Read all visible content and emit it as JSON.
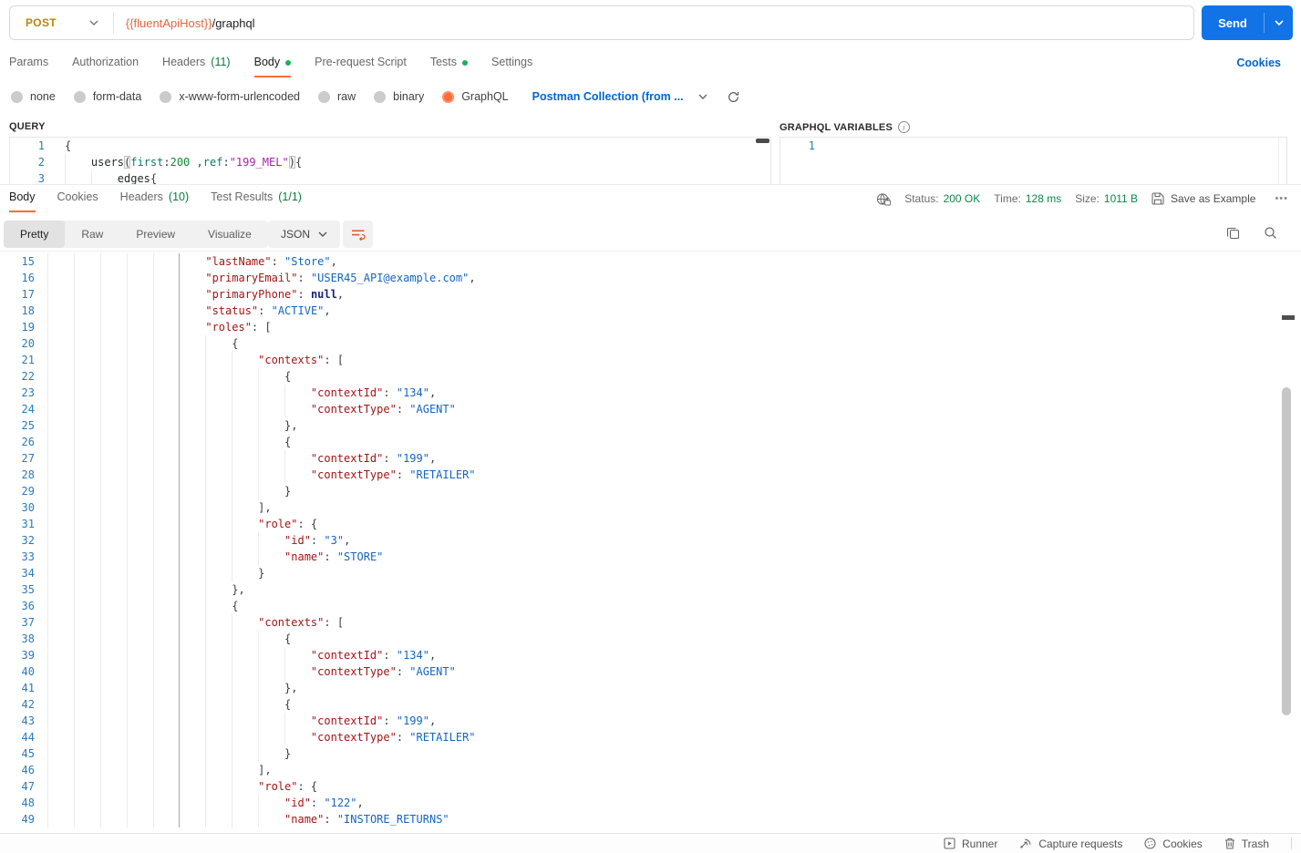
{
  "colors": {
    "accent": "#ff6c37",
    "link": "#0265d2",
    "send_button": "#1173e6",
    "method_post": "#b7860f",
    "url_variable": "#ef6240",
    "success_green": "#077d3e",
    "status_green": "#0a8a4a",
    "dot_green": "#1bb05c",
    "json_key": "#a31515",
    "json_string": "#1565c0",
    "json_null": "#1a237e",
    "line_number": "#2a7ab9"
  },
  "request": {
    "method": "POST",
    "url": {
      "variable": "{{fluentApiHost}}",
      "path": "/graphql"
    },
    "send_label": "Send",
    "cookies_link": "Cookies",
    "tabs": [
      {
        "label": "Params"
      },
      {
        "label": "Authorization"
      },
      {
        "label": "Headers",
        "count": "(11)"
      },
      {
        "label": "Body",
        "dot": true,
        "active": true
      },
      {
        "label": "Pre-request Script"
      },
      {
        "label": "Tests",
        "dot": true
      },
      {
        "label": "Settings"
      }
    ],
    "body_modes": [
      {
        "label": "none"
      },
      {
        "label": "form-data"
      },
      {
        "label": "x-www-form-urlencoded"
      },
      {
        "label": "raw"
      },
      {
        "label": "binary"
      },
      {
        "label": "GraphQL",
        "selected": true
      }
    ],
    "schema_dropdown_label": "Postman Collection (from ...",
    "query": {
      "label": "QUERY",
      "lines": [
        {
          "n": 1,
          "i": 0,
          "t": [
            [
              "p",
              "{"
            ]
          ]
        },
        {
          "n": 2,
          "i": 1,
          "t": [
            [
              "id",
              "users"
            ],
            [
              "b",
              "("
            ],
            [
              "a",
              "first"
            ],
            [
              "p",
              ":"
            ],
            [
              "num",
              "200"
            ],
            [
              "p",
              " ,"
            ],
            [
              "a",
              "ref"
            ],
            [
              "p",
              ":"
            ],
            [
              "str",
              "\"199_MEL\""
            ],
            [
              "b",
              ")"
            ],
            [
              "p",
              "{"
            ]
          ]
        },
        {
          "n": 3,
          "i": 2,
          "t": [
            [
              "id",
              "edges"
            ],
            [
              "p",
              "{"
            ]
          ]
        }
      ]
    },
    "variables": {
      "label": "GRAPHQL VARIABLES",
      "lines": [
        {
          "n": 1,
          "i": 0,
          "t": []
        }
      ]
    }
  },
  "response": {
    "tabs": [
      {
        "label": "Body",
        "active": true
      },
      {
        "label": "Cookies"
      },
      {
        "label": "Headers",
        "count": "(10)"
      },
      {
        "label": "Test Results",
        "count": "(1/1)"
      }
    ],
    "meta": {
      "status_label": "Status:",
      "status_value": "200 OK",
      "time_label": "Time:",
      "time_value": "128 ms",
      "size_label": "Size:",
      "size_value": "1011 B",
      "save_as_example": "Save as Example",
      "more_icon": "•••"
    },
    "view_tabs": [
      {
        "label": "Pretty",
        "active": true
      },
      {
        "label": "Raw"
      },
      {
        "label": "Preview"
      },
      {
        "label": "Visualize"
      }
    ],
    "language_dropdown": "JSON",
    "body_lines": [
      {
        "n": 15,
        "i": 6,
        "t": [
          [
            "k",
            "\"lastName\""
          ],
          [
            "p",
            ": "
          ],
          [
            "s",
            "\"Store\""
          ],
          [
            "p",
            ","
          ]
        ]
      },
      {
        "n": 16,
        "i": 6,
        "t": [
          [
            "k",
            "\"primaryEmail\""
          ],
          [
            "p",
            ": "
          ],
          [
            "s",
            "\"USER45_API@example.com\""
          ],
          [
            "p",
            ","
          ]
        ]
      },
      {
        "n": 17,
        "i": 6,
        "t": [
          [
            "k",
            "\"primaryPhone\""
          ],
          [
            "p",
            ": "
          ],
          [
            "n",
            "null"
          ],
          [
            "p",
            ","
          ]
        ]
      },
      {
        "n": 18,
        "i": 6,
        "t": [
          [
            "k",
            "\"status\""
          ],
          [
            "p",
            ": "
          ],
          [
            "s",
            "\"ACTIVE\""
          ],
          [
            "p",
            ","
          ]
        ]
      },
      {
        "n": 19,
        "i": 6,
        "t": [
          [
            "k",
            "\"roles\""
          ],
          [
            "p",
            ": ["
          ]
        ]
      },
      {
        "n": 20,
        "i": 7,
        "t": [
          [
            "p",
            "{"
          ]
        ]
      },
      {
        "n": 21,
        "i": 8,
        "t": [
          [
            "k",
            "\"contexts\""
          ],
          [
            "p",
            ": ["
          ]
        ]
      },
      {
        "n": 22,
        "i": 9,
        "t": [
          [
            "p",
            "{"
          ]
        ]
      },
      {
        "n": 23,
        "i": 10,
        "t": [
          [
            "k",
            "\"contextId\""
          ],
          [
            "p",
            ": "
          ],
          [
            "s",
            "\"134\""
          ],
          [
            "p",
            ","
          ]
        ]
      },
      {
        "n": 24,
        "i": 10,
        "t": [
          [
            "k",
            "\"contextType\""
          ],
          [
            "p",
            ": "
          ],
          [
            "s",
            "\"AGENT\""
          ]
        ]
      },
      {
        "n": 25,
        "i": 9,
        "t": [
          [
            "p",
            "},"
          ]
        ]
      },
      {
        "n": 26,
        "i": 9,
        "t": [
          [
            "p",
            "{"
          ]
        ]
      },
      {
        "n": 27,
        "i": 10,
        "t": [
          [
            "k",
            "\"contextId\""
          ],
          [
            "p",
            ": "
          ],
          [
            "s",
            "\"199\""
          ],
          [
            "p",
            ","
          ]
        ]
      },
      {
        "n": 28,
        "i": 10,
        "t": [
          [
            "k",
            "\"contextType\""
          ],
          [
            "p",
            ": "
          ],
          [
            "s",
            "\"RETAILER\""
          ]
        ]
      },
      {
        "n": 29,
        "i": 9,
        "t": [
          [
            "p",
            "}"
          ]
        ]
      },
      {
        "n": 30,
        "i": 8,
        "t": [
          [
            "p",
            "],"
          ]
        ]
      },
      {
        "n": 31,
        "i": 8,
        "t": [
          [
            "k",
            "\"role\""
          ],
          [
            "p",
            ": {"
          ]
        ]
      },
      {
        "n": 32,
        "i": 9,
        "t": [
          [
            "k",
            "\"id\""
          ],
          [
            "p",
            ": "
          ],
          [
            "s",
            "\"3\""
          ],
          [
            "p",
            ","
          ]
        ]
      },
      {
        "n": 33,
        "i": 9,
        "t": [
          [
            "k",
            "\"name\""
          ],
          [
            "p",
            ": "
          ],
          [
            "s",
            "\"STORE\""
          ]
        ]
      },
      {
        "n": 34,
        "i": 8,
        "t": [
          [
            "p",
            "}"
          ]
        ]
      },
      {
        "n": 35,
        "i": 7,
        "t": [
          [
            "p",
            "},"
          ]
        ]
      },
      {
        "n": 36,
        "i": 7,
        "t": [
          [
            "p",
            "{"
          ]
        ]
      },
      {
        "n": 37,
        "i": 8,
        "t": [
          [
            "k",
            "\"contexts\""
          ],
          [
            "p",
            ": ["
          ]
        ]
      },
      {
        "n": 38,
        "i": 9,
        "t": [
          [
            "p",
            "{"
          ]
        ]
      },
      {
        "n": 39,
        "i": 10,
        "t": [
          [
            "k",
            "\"contextId\""
          ],
          [
            "p",
            ": "
          ],
          [
            "s",
            "\"134\""
          ],
          [
            "p",
            ","
          ]
        ]
      },
      {
        "n": 40,
        "i": 10,
        "t": [
          [
            "k",
            "\"contextType\""
          ],
          [
            "p",
            ": "
          ],
          [
            "s",
            "\"AGENT\""
          ]
        ]
      },
      {
        "n": 41,
        "i": 9,
        "t": [
          [
            "p",
            "},"
          ]
        ]
      },
      {
        "n": 42,
        "i": 9,
        "t": [
          [
            "p",
            "{"
          ]
        ]
      },
      {
        "n": 43,
        "i": 10,
        "t": [
          [
            "k",
            "\"contextId\""
          ],
          [
            "p",
            ": "
          ],
          [
            "s",
            "\"199\""
          ],
          [
            "p",
            ","
          ]
        ]
      },
      {
        "n": 44,
        "i": 10,
        "t": [
          [
            "k",
            "\"contextType\""
          ],
          [
            "p",
            ": "
          ],
          [
            "s",
            "\"RETAILER\""
          ]
        ]
      },
      {
        "n": 45,
        "i": 9,
        "t": [
          [
            "p",
            "}"
          ]
        ]
      },
      {
        "n": 46,
        "i": 8,
        "t": [
          [
            "p",
            "],"
          ]
        ]
      },
      {
        "n": 47,
        "i": 8,
        "t": [
          [
            "k",
            "\"role\""
          ],
          [
            "p",
            ": {"
          ]
        ]
      },
      {
        "n": 48,
        "i": 9,
        "t": [
          [
            "k",
            "\"id\""
          ],
          [
            "p",
            ": "
          ],
          [
            "s",
            "\"122\""
          ],
          [
            "p",
            ","
          ]
        ]
      },
      {
        "n": 49,
        "i": 9,
        "t": [
          [
            "k",
            "\"name\""
          ],
          [
            "p",
            ": "
          ],
          [
            "s",
            "\"INSTORE_RETURNS\""
          ]
        ]
      }
    ]
  },
  "footer": {
    "runner": "Runner",
    "capture": "Capture requests",
    "cookies": "Cookies",
    "trash": "Trash"
  }
}
